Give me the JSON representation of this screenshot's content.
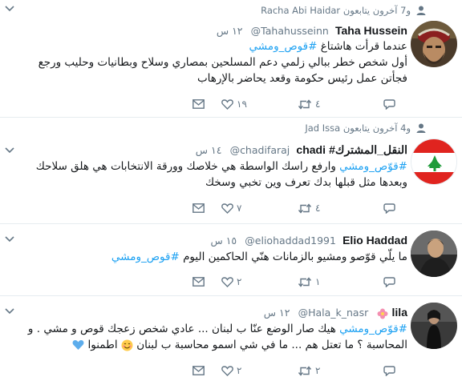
{
  "tweets": [
    {
      "social_context": {
        "actor": "Racha Abi Haidar",
        "rest": "و7 آخرون يتابعون"
      },
      "name": "Taha Hussein",
      "handle": "@Tahahusseinn",
      "time": "١٢ س",
      "text_before": "عندما قرأت هاشتاغ ",
      "hashtag": "#قوص_ومشي",
      "text_after": "",
      "line2": "أول شخص خطر ببالي زلمي دعم المسلحين بمصاري وسلاح وبطانيات وحليب ورجع",
      "line3": "فجأتن عمل رئيس حكومة وقعد يحاضر بالإرهاب",
      "replies": "",
      "retweets": "٤",
      "likes": "١٩"
    },
    {
      "social_context": {
        "actor": "Jad Issa",
        "rest": "و4 آخرون يتابعون"
      },
      "name": "chadi",
      "name_suffix": "#النقل_المشترك",
      "handle": "@chadifaraj",
      "time": "١٤ س",
      "hashtag": "#قوّص_ومشي",
      "text_after": " وارفع راسك الواسطة هي خلاصك وورقة الانتخابات هي هلق سلاحك",
      "line2": "وبعدها مثل قبلها بدك تعرف وين تخبي وسخك",
      "replies": "",
      "retweets": "٤",
      "likes": "٧"
    },
    {
      "name": "Elio Haddad",
      "handle": "@eliohaddad1991",
      "time": "١٥ س",
      "text_before": "ما يلّي قوّصو ومشيو بالزمانات هنّي الحاكمين اليوم ",
      "hashtag": "#قوص_ومشي",
      "replies": "",
      "retweets": "١",
      "likes": "٢"
    },
    {
      "name": "lila",
      "handle": "@Hala_k_nasr",
      "time": "١٢ س",
      "hashtag": "#قوّص_ومشي",
      "text_after": " هيك صار الوضع عنّا ب لبنان ... عادي شخص زعجك قوص و مشي . و",
      "line2": "المحاسبة ؟ ما تعتل هم ... ما في شي اسمو محاسبة ب لبنان",
      "line2_tail": " اطمنوا",
      "replies": "",
      "retweets": "٢",
      "likes": "٢"
    }
  ],
  "colors": {
    "link": "#1da1f2",
    "muted": "#657786",
    "border": "#e6ecf0"
  }
}
